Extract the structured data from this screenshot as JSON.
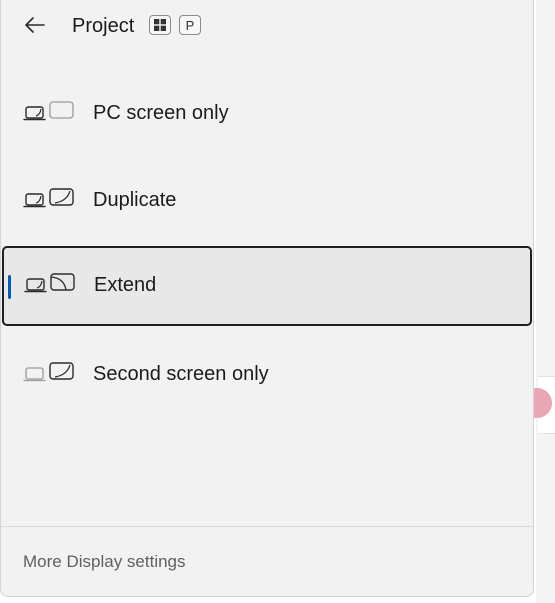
{
  "header": {
    "title": "Project",
    "shortcut_keys": [
      "⊞",
      "P"
    ]
  },
  "options": [
    {
      "label": "PC screen only",
      "icon": "pc-screen-only-icon",
      "selected": false
    },
    {
      "label": "Duplicate",
      "icon": "duplicate-icon",
      "selected": false
    },
    {
      "label": "Extend",
      "icon": "extend-icon",
      "selected": true
    },
    {
      "label": "Second screen only",
      "icon": "second-screen-only-icon",
      "selected": false
    }
  ],
  "footer": {
    "link_label": "More Display settings"
  },
  "colors": {
    "accent": "#005fb8",
    "panel": "#f2f2f2",
    "selected_bg": "#e8e8e8"
  }
}
